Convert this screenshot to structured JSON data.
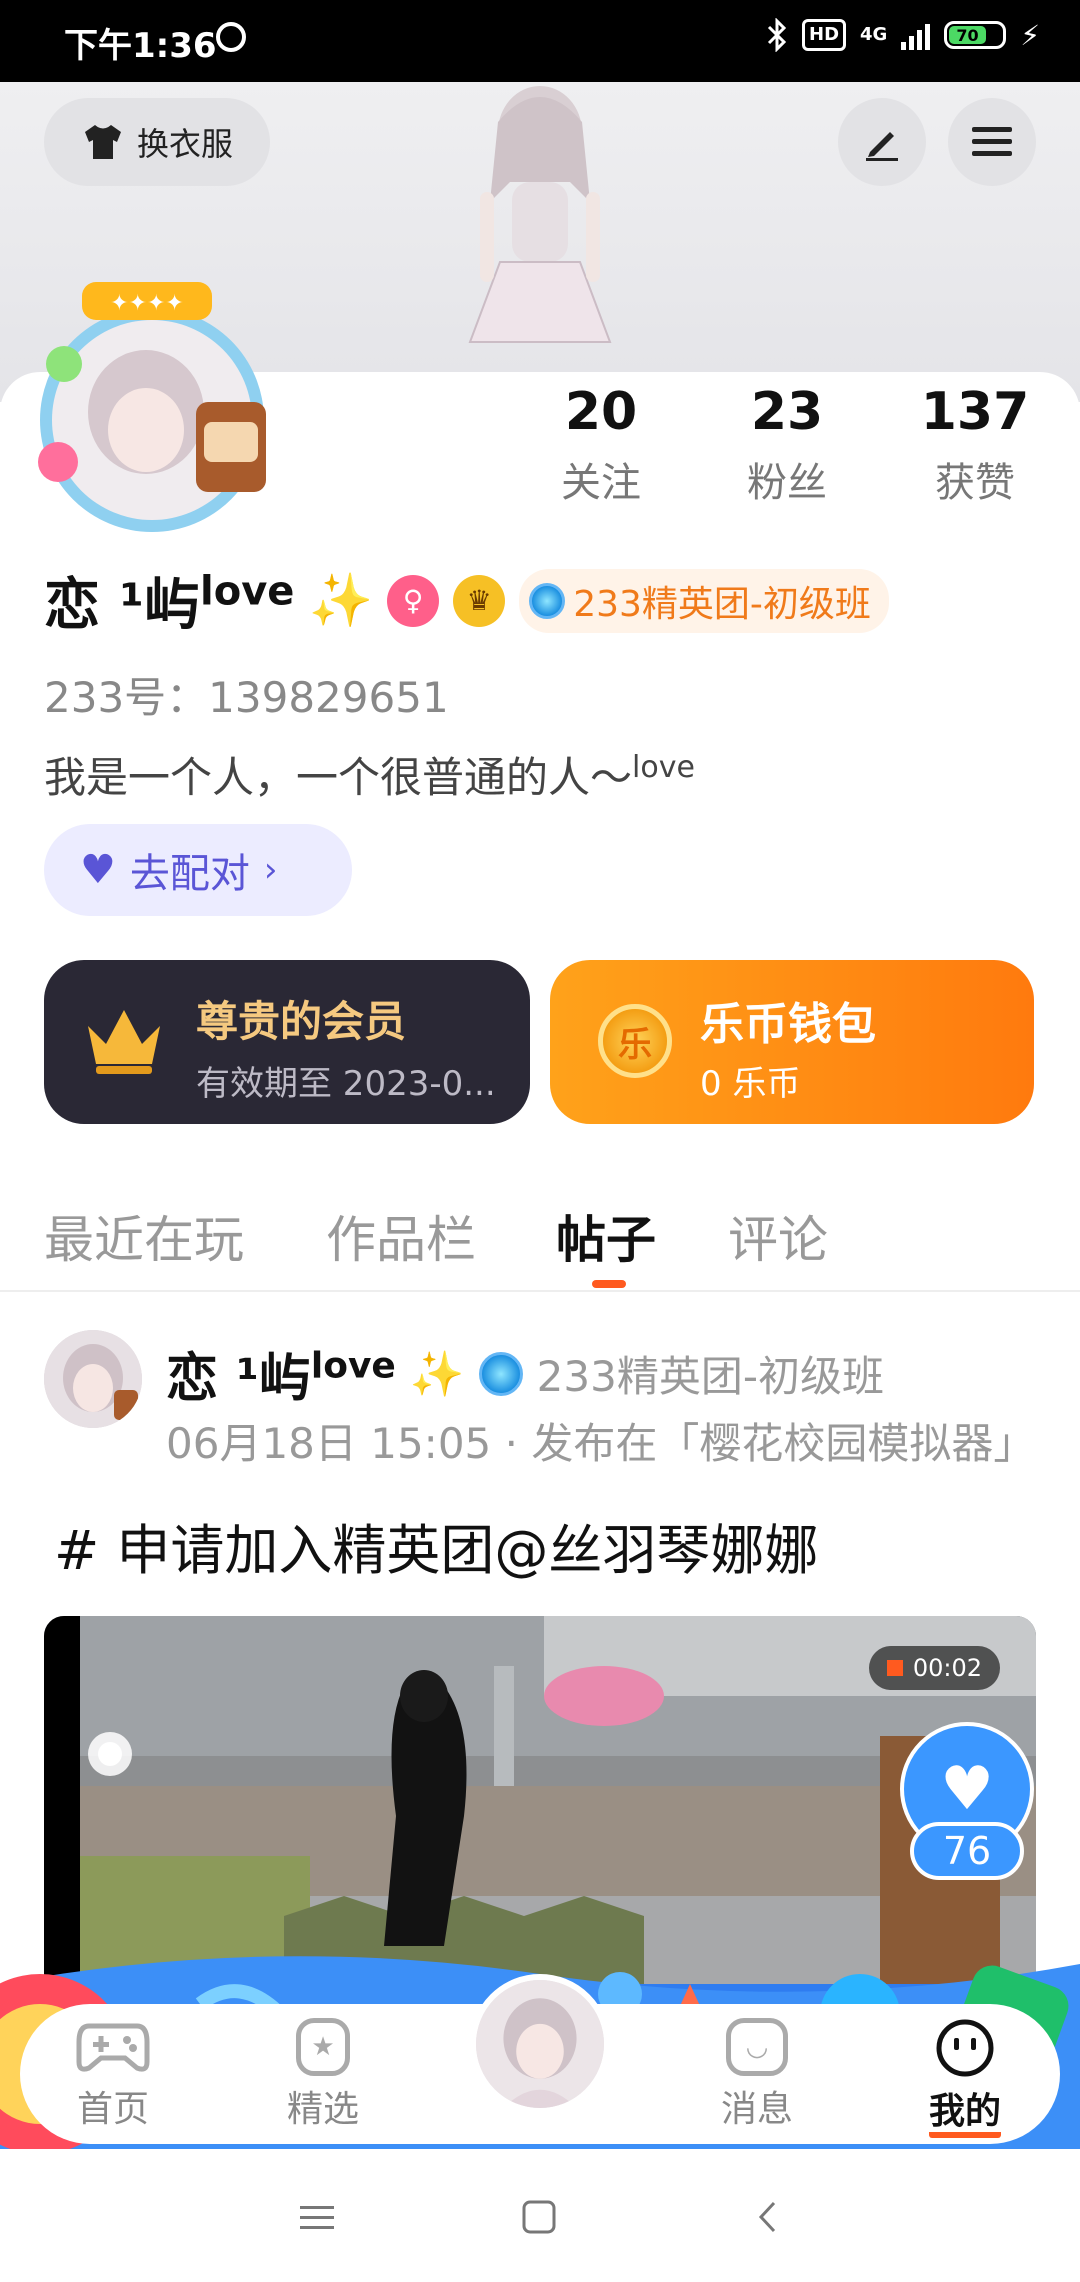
{
  "status_bar": {
    "time": "下午1:36",
    "hd": "HD",
    "network": "4G",
    "battery": "70"
  },
  "header": {
    "outfit_button": "换衣服"
  },
  "profile": {
    "stats": [
      {
        "value": "20",
        "label": "关注"
      },
      {
        "value": "23",
        "label": "粉丝"
      },
      {
        "value": "137",
        "label": "获赞"
      }
    ],
    "name": "恋 ¹屿",
    "name_suffix": "love",
    "club_badge": "233精英团-初级班",
    "id_text": "233号：139829651",
    "bio": "我是一个人，一个很普通的人～",
    "bio_suffix": "love",
    "match_button": "去配对"
  },
  "cards": {
    "vip": {
      "title": "尊贵的会员",
      "subtitle": "有效期至 2023-0..."
    },
    "wallet": {
      "title": "乐币钱包",
      "subtitle": "0 乐币",
      "coin_glyph": "乐"
    }
  },
  "tabs": [
    "最近在玩",
    "作品栏",
    "帖子",
    "评论"
  ],
  "post": {
    "author": "恋 ¹屿",
    "author_suffix": "love",
    "club": "233精英团-初级班",
    "meta": "06月18日 15:05 · 发布在「樱花校园模拟器」",
    "title": "# 申请加入精英团@丝羽琴娜娜",
    "video_time": "00:02",
    "likes": "76"
  },
  "bottom_nav": [
    {
      "label": "首页",
      "icon": "gamepad-icon"
    },
    {
      "label": "精选",
      "icon": "star-bookmark-icon"
    },
    {
      "label": "消息",
      "icon": "chat-bubble-icon"
    },
    {
      "label": "我的",
      "icon": "smiley-face-icon"
    }
  ],
  "colors": {
    "accent": "#ff5a1f",
    "club_orange": "#f07a1a",
    "like_blue": "#3b97ff",
    "vip_dark": "#2a2835"
  }
}
